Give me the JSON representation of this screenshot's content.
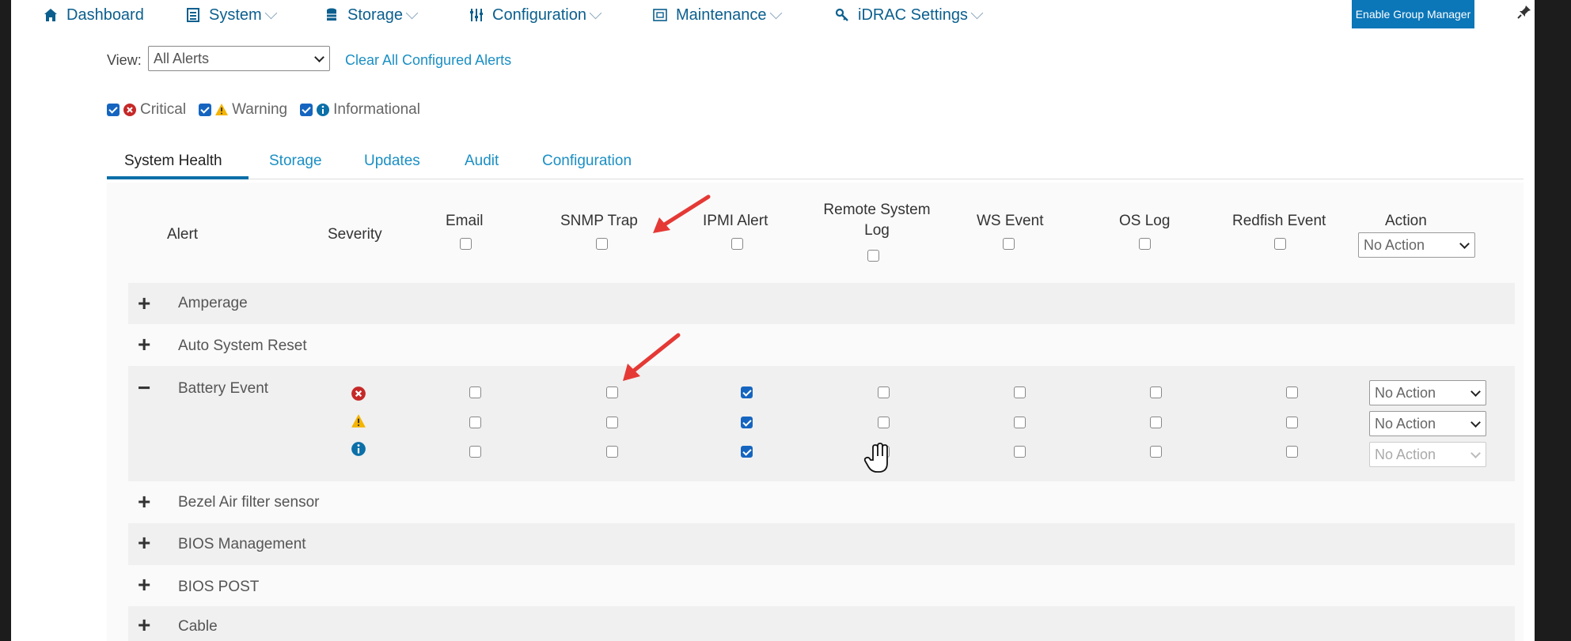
{
  "nav": {
    "items": [
      {
        "label": "Dashboard",
        "icon": "home-icon"
      },
      {
        "label": "System",
        "icon": "server-icon"
      },
      {
        "label": "Storage",
        "icon": "database-icon"
      },
      {
        "label": "Configuration",
        "icon": "sliders-icon"
      },
      {
        "label": "Maintenance",
        "icon": "maintenance-icon"
      },
      {
        "label": "iDRAC Settings",
        "icon": "key-icon"
      }
    ],
    "group_manager_button": "Enable Group Manager"
  },
  "view": {
    "label": "View:",
    "selected": "All Alerts",
    "clear_link": "Clear All Configured Alerts"
  },
  "filters": [
    {
      "label": "Critical",
      "checked": true,
      "icon": "critical-icon"
    },
    {
      "label": "Warning",
      "checked": true,
      "icon": "warning-icon"
    },
    {
      "label": "Informational",
      "checked": true,
      "icon": "info-icon"
    }
  ],
  "tabs": [
    "System Health",
    "Storage",
    "Updates",
    "Audit",
    "Configuration"
  ],
  "active_tab": "System Health",
  "columns": {
    "alert": "Alert",
    "severity": "Severity",
    "email": "Email",
    "snmp": "SNMP Trap",
    "ipmi": "IPMI Alert",
    "remote_line1": "Remote System",
    "remote_line2": "Log",
    "ws": "WS Event",
    "oslog": "OS Log",
    "redfish": "Redfish Event",
    "action": "Action"
  },
  "header_action": "No Action",
  "categories": [
    {
      "sign": "+",
      "label": "Amperage"
    },
    {
      "sign": "+",
      "label": "Auto System Reset"
    },
    {
      "sign": "−",
      "label": "Battery Event"
    },
    {
      "sign": "+",
      "label": "Bezel Air filter sensor"
    },
    {
      "sign": "+",
      "label": "BIOS Management"
    },
    {
      "sign": "+",
      "label": "BIOS POST"
    },
    {
      "sign": "+",
      "label": "Cable"
    }
  ],
  "battery_rows": [
    {
      "severity_icon": "critical-icon",
      "email": false,
      "snmp": false,
      "ipmi": true,
      "remote": false,
      "ws": false,
      "oslog": false,
      "redfish": false,
      "action": "No Action"
    },
    {
      "severity_icon": "warning-icon",
      "email": false,
      "snmp": false,
      "ipmi": true,
      "remote": false,
      "ws": false,
      "oslog": false,
      "redfish": false,
      "action": "No Action"
    },
    {
      "severity_icon": "info-icon",
      "email": false,
      "snmp": false,
      "ipmi": true,
      "remote": false,
      "ws": false,
      "oslog": false,
      "redfish": false,
      "action": "No Action"
    }
  ],
  "colors": {
    "nav_text": "#0b5f8e",
    "link": "#1a8fc4",
    "button": "#0b76b8",
    "checkbox_on": "#1565c0",
    "critical": "#c62828",
    "warning": "#f5b400",
    "info": "#0b6fa8",
    "annotation_arrow": "#e53935"
  }
}
